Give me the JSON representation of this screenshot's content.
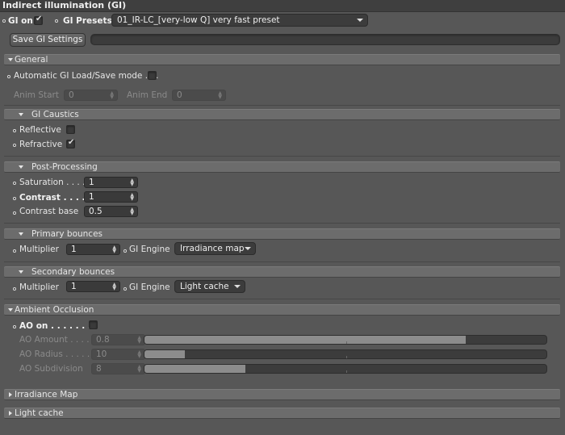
{
  "window": {
    "title": "Indirect illumination (GI)"
  },
  "header": {
    "gi_on_label": "GI on",
    "gi_on_checked": true,
    "presets_label": "GI Presets",
    "preset_value": "01_IR-LC_[very-low Q] very fast preset",
    "save_button": "Save GI Settings",
    "save_path": ""
  },
  "general": {
    "title": "General",
    "auto_label": "Automatic GI Load/Save mode . . .",
    "auto_checked": false,
    "anim_start_label": "Anim Start",
    "anim_start_value": "0",
    "anim_end_label": "Anim End",
    "anim_end_value": "0"
  },
  "caustics": {
    "title": "GI Caustics",
    "reflective_label": "Reflective",
    "reflective_checked": false,
    "refractive_label": "Refractive",
    "refractive_checked": true
  },
  "post": {
    "title": "Post-Processing",
    "saturation_label": "Saturation . . . .",
    "saturation_value": "1",
    "contrast_label": "Contrast . . . . .",
    "contrast_value": "1",
    "contrast_base_label": "Contrast base",
    "contrast_base_value": "0.5"
  },
  "primary": {
    "title": "Primary bounces",
    "multiplier_label": "Multiplier",
    "multiplier_value": "1",
    "engine_label": "GI Engine",
    "engine_value": "Irradiance map"
  },
  "secondary": {
    "title": "Secondary bounces",
    "multiplier_label": "Multiplier",
    "multiplier_value": "1",
    "engine_label": "GI Engine",
    "engine_value": "Light cache"
  },
  "ao": {
    "title": "Ambient Occlusion",
    "on_label": "AO on . . . . . . . .",
    "on_checked": false,
    "amount_label": "AO Amount . . . .",
    "amount_value": "0.8",
    "amount_fill": 0.8,
    "radius_label": "AO Radius . . . . .",
    "radius_value": "10",
    "radius_fill": 0.1,
    "subdiv_label": "AO Subdivision",
    "subdiv_value": "8",
    "subdiv_fill": 0.25
  },
  "collapsed": {
    "irradiance_title": "Irradiance Map",
    "light_cache_title": "Light cache"
  },
  "icons": {
    "checkmark": "checkmark-icon",
    "dropdown": "triangle-down-icon",
    "expand": "disclosure-triangle-icon",
    "spinner": "spinner-arrows-icon",
    "param_dot": "parameter-dot-icon"
  }
}
